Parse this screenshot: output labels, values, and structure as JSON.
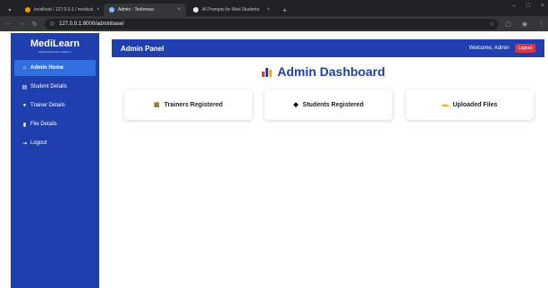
{
  "browser": {
    "tabs": [
      {
        "label": "localhost / 127.0.0.1 / medical",
        "close": "×",
        "active": false,
        "icon_color": "#f29900"
      },
      {
        "label": "Admin - Technova",
        "close": "×",
        "active": true,
        "icon_color": "#8ab4f8"
      },
      {
        "label": "AI Prompts for Med Students",
        "close": "×",
        "active": false,
        "icon_color": "#e8eaed"
      },
      {
        "label": "+",
        "close": "",
        "active": false,
        "icon_color": ""
      }
    ],
    "url": "127.0.0.1:8000/adminbase/",
    "window_controls": [
      "–",
      "□",
      "×"
    ]
  },
  "sidebar": {
    "brand": "MediLearn",
    "tagline": "Medical Education Platform",
    "items": [
      {
        "label": "Admin Home",
        "icon": "home-icon",
        "glyph": "⌂",
        "active": true
      },
      {
        "label": "Student Details",
        "icon": "students-icon",
        "glyph": "▤",
        "active": false
      },
      {
        "label": "Trainer Details",
        "icon": "user-icon",
        "glyph": "●",
        "active": false
      },
      {
        "label": "File Details",
        "icon": "file-icon",
        "glyph": "▮",
        "active": false
      },
      {
        "label": "Logout",
        "icon": "logout-icon",
        "glyph": "⇥",
        "active": false
      }
    ]
  },
  "header": {
    "title": "Admin Panel",
    "welcome": "Welcome, Admin",
    "logout_label": "Logout"
  },
  "dashboard": {
    "title": "Admin Dashboard",
    "cards": [
      {
        "label": "Trainers Registered",
        "icon": "trainers-icon",
        "glyph": "▦",
        "color": "#8d6e1f"
      },
      {
        "label": "Students Registered",
        "icon": "graduation-cap-icon",
        "glyph": "◆",
        "color": "#111111"
      },
      {
        "label": "Uploaded Files",
        "icon": "folder-icon",
        "glyph": "▬",
        "color": "#f4b400"
      }
    ]
  },
  "colors": {
    "brand_blue": "#1f3fae",
    "active_item": "#2f6fe0",
    "logout_red": "#dc3545"
  }
}
